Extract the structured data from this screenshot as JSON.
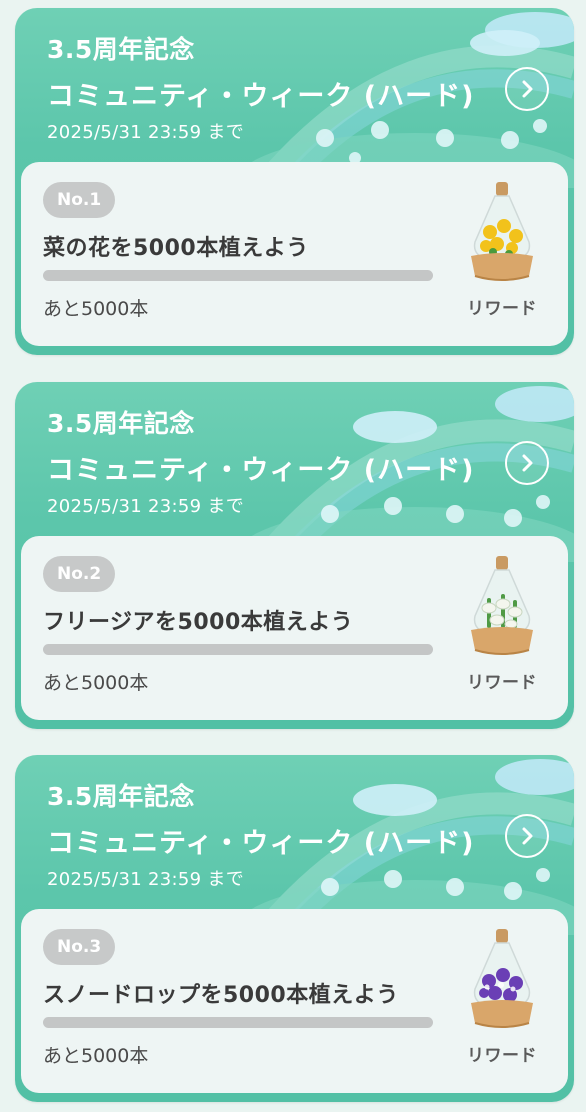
{
  "cards": [
    {
      "anniversary": "3.5周年記念",
      "event_title": "コミュニティ・ウィーク (ハード)",
      "deadline": "2025/5/31 23:59 まで",
      "number": "No.1",
      "mission": "菜の花を5000本植えよう",
      "remaining": "あと5000本",
      "progress": 0,
      "reward_label": "リワード",
      "reward_icon": "yellow-flower-vase-icon",
      "flower_color": "#f2c21b"
    },
    {
      "anniversary": "3.5周年記念",
      "event_title": "コミュニティ・ウィーク (ハード)",
      "deadline": "2025/5/31 23:59 まで",
      "number": "No.2",
      "mission": "フリージアを5000本植えよう",
      "remaining": "あと5000本",
      "progress": 0,
      "reward_label": "リワード",
      "reward_icon": "white-flower-vase-icon",
      "flower_color": "#f4f6ee"
    },
    {
      "anniversary": "3.5周年記念",
      "event_title": "コミュニティ・ウィーク (ハード)",
      "deadline": "2025/5/31 23:59 まで",
      "number": "No.3",
      "mission": "スノードロップを5000本植えよう",
      "remaining": "あと5000本",
      "progress": 0,
      "reward_label": "リワード",
      "reward_icon": "purple-flower-vase-icon",
      "flower_color": "#6a3fb5"
    }
  ],
  "colors": {
    "card_green": "#5cc6ab",
    "panel": "#eef5f4",
    "badge_gray": "#c7c9c9",
    "progress_track": "#c4c6c6"
  }
}
